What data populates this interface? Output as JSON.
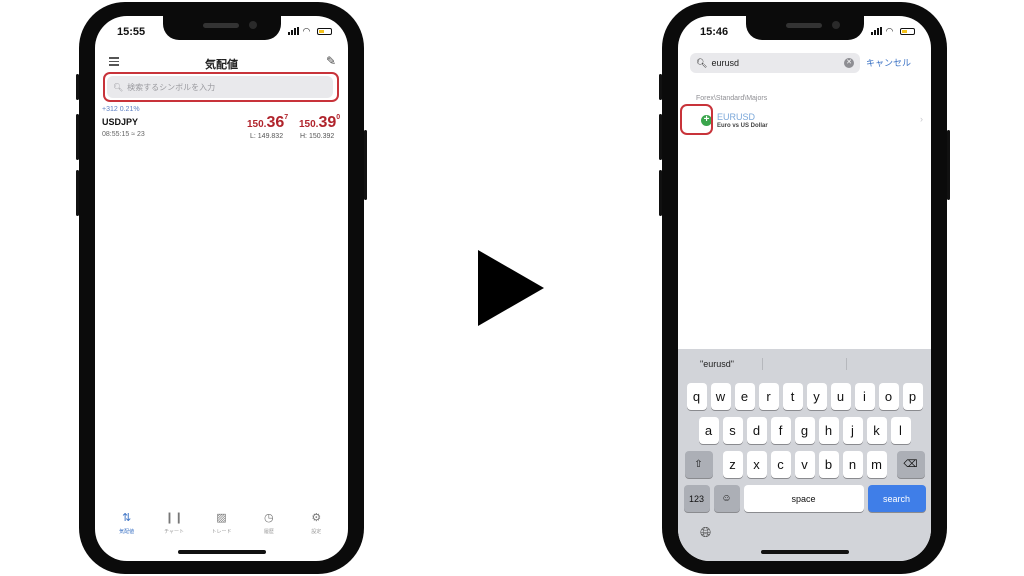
{
  "left_phone": {
    "status_time": "15:55",
    "nav_title": "気配値",
    "search_placeholder": "検索するシンボルを入力",
    "quote": {
      "change": "+312 0.21%",
      "symbol": "USDJPY",
      "time": "08:55:15 ≈ 23",
      "bid_prefix": "150.",
      "bid_big": "36",
      "bid_sup": "7",
      "ask_prefix": "150.",
      "ask_big": "39",
      "ask_sup": "0",
      "low": "L: 149.832",
      "high": "H: 150.392"
    },
    "tabs": [
      {
        "label": "気配値",
        "icon": "arrows-icon"
      },
      {
        "label": "チャート",
        "icon": "candles-icon"
      },
      {
        "label": "トレード",
        "icon": "trade-chart-icon"
      },
      {
        "label": "履歴",
        "icon": "clock-icon"
      },
      {
        "label": "設定",
        "icon": "gear-icon"
      }
    ]
  },
  "right_phone": {
    "status_time": "15:46",
    "search_value": "eurusd",
    "cancel_label": "キャンセル",
    "section_label": "Forex\\Standard\\Majors",
    "result": {
      "symbol": "EURUSD",
      "description": "Euro vs US Dollar"
    },
    "suggestion": "\"eurusd\"",
    "keyboard": {
      "row1": [
        "q",
        "w",
        "e",
        "r",
        "t",
        "y",
        "u",
        "i",
        "o",
        "p"
      ],
      "row2": [
        "a",
        "s",
        "d",
        "f",
        "g",
        "h",
        "j",
        "k",
        "l"
      ],
      "row3": [
        "z",
        "x",
        "c",
        "v",
        "b",
        "n",
        "m"
      ],
      "num_label": "123",
      "space_label": "space",
      "search_label": "search"
    }
  },
  "colors": {
    "highlight_frame": "#c8333a",
    "price_red": "#b0242c",
    "accent_blue": "#3b72c4",
    "add_green": "#3aa54c"
  }
}
